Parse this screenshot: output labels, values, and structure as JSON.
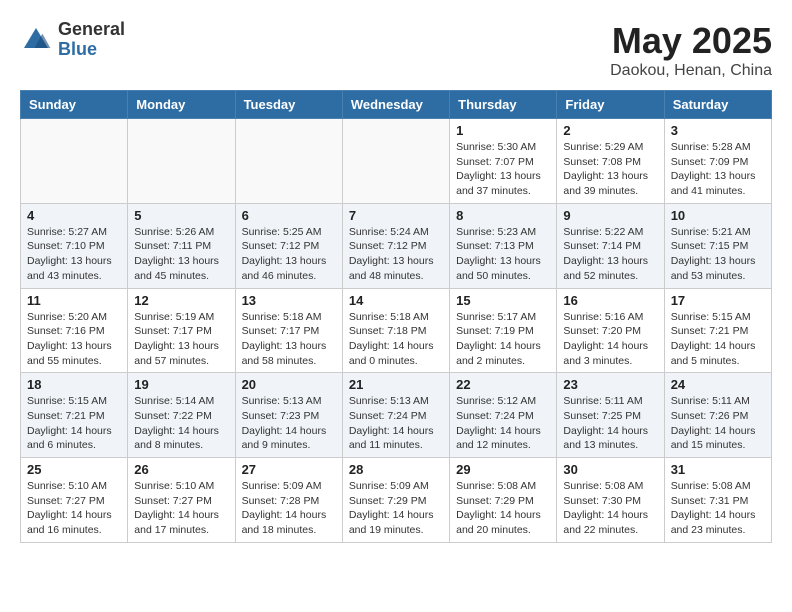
{
  "logo": {
    "general": "General",
    "blue": "Blue"
  },
  "title": {
    "month_year": "May 2025",
    "location": "Daokou, Henan, China"
  },
  "headers": [
    "Sunday",
    "Monday",
    "Tuesday",
    "Wednesday",
    "Thursday",
    "Friday",
    "Saturday"
  ],
  "weeks": [
    [
      {
        "day": "",
        "info": ""
      },
      {
        "day": "",
        "info": ""
      },
      {
        "day": "",
        "info": ""
      },
      {
        "day": "",
        "info": ""
      },
      {
        "day": "1",
        "info": "Sunrise: 5:30 AM\nSunset: 7:07 PM\nDaylight: 13 hours\nand 37 minutes."
      },
      {
        "day": "2",
        "info": "Sunrise: 5:29 AM\nSunset: 7:08 PM\nDaylight: 13 hours\nand 39 minutes."
      },
      {
        "day": "3",
        "info": "Sunrise: 5:28 AM\nSunset: 7:09 PM\nDaylight: 13 hours\nand 41 minutes."
      }
    ],
    [
      {
        "day": "4",
        "info": "Sunrise: 5:27 AM\nSunset: 7:10 PM\nDaylight: 13 hours\nand 43 minutes."
      },
      {
        "day": "5",
        "info": "Sunrise: 5:26 AM\nSunset: 7:11 PM\nDaylight: 13 hours\nand 45 minutes."
      },
      {
        "day": "6",
        "info": "Sunrise: 5:25 AM\nSunset: 7:12 PM\nDaylight: 13 hours\nand 46 minutes."
      },
      {
        "day": "7",
        "info": "Sunrise: 5:24 AM\nSunset: 7:12 PM\nDaylight: 13 hours\nand 48 minutes."
      },
      {
        "day": "8",
        "info": "Sunrise: 5:23 AM\nSunset: 7:13 PM\nDaylight: 13 hours\nand 50 minutes."
      },
      {
        "day": "9",
        "info": "Sunrise: 5:22 AM\nSunset: 7:14 PM\nDaylight: 13 hours\nand 52 minutes."
      },
      {
        "day": "10",
        "info": "Sunrise: 5:21 AM\nSunset: 7:15 PM\nDaylight: 13 hours\nand 53 minutes."
      }
    ],
    [
      {
        "day": "11",
        "info": "Sunrise: 5:20 AM\nSunset: 7:16 PM\nDaylight: 13 hours\nand 55 minutes."
      },
      {
        "day": "12",
        "info": "Sunrise: 5:19 AM\nSunset: 7:17 PM\nDaylight: 13 hours\nand 57 minutes."
      },
      {
        "day": "13",
        "info": "Sunrise: 5:18 AM\nSunset: 7:17 PM\nDaylight: 13 hours\nand 58 minutes."
      },
      {
        "day": "14",
        "info": "Sunrise: 5:18 AM\nSunset: 7:18 PM\nDaylight: 14 hours\nand 0 minutes."
      },
      {
        "day": "15",
        "info": "Sunrise: 5:17 AM\nSunset: 7:19 PM\nDaylight: 14 hours\nand 2 minutes."
      },
      {
        "day": "16",
        "info": "Sunrise: 5:16 AM\nSunset: 7:20 PM\nDaylight: 14 hours\nand 3 minutes."
      },
      {
        "day": "17",
        "info": "Sunrise: 5:15 AM\nSunset: 7:21 PM\nDaylight: 14 hours\nand 5 minutes."
      }
    ],
    [
      {
        "day": "18",
        "info": "Sunrise: 5:15 AM\nSunset: 7:21 PM\nDaylight: 14 hours\nand 6 minutes."
      },
      {
        "day": "19",
        "info": "Sunrise: 5:14 AM\nSunset: 7:22 PM\nDaylight: 14 hours\nand 8 minutes."
      },
      {
        "day": "20",
        "info": "Sunrise: 5:13 AM\nSunset: 7:23 PM\nDaylight: 14 hours\nand 9 minutes."
      },
      {
        "day": "21",
        "info": "Sunrise: 5:13 AM\nSunset: 7:24 PM\nDaylight: 14 hours\nand 11 minutes."
      },
      {
        "day": "22",
        "info": "Sunrise: 5:12 AM\nSunset: 7:24 PM\nDaylight: 14 hours\nand 12 minutes."
      },
      {
        "day": "23",
        "info": "Sunrise: 5:11 AM\nSunset: 7:25 PM\nDaylight: 14 hours\nand 13 minutes."
      },
      {
        "day": "24",
        "info": "Sunrise: 5:11 AM\nSunset: 7:26 PM\nDaylight: 14 hours\nand 15 minutes."
      }
    ],
    [
      {
        "day": "25",
        "info": "Sunrise: 5:10 AM\nSunset: 7:27 PM\nDaylight: 14 hours\nand 16 minutes."
      },
      {
        "day": "26",
        "info": "Sunrise: 5:10 AM\nSunset: 7:27 PM\nDaylight: 14 hours\nand 17 minutes."
      },
      {
        "day": "27",
        "info": "Sunrise: 5:09 AM\nSunset: 7:28 PM\nDaylight: 14 hours\nand 18 minutes."
      },
      {
        "day": "28",
        "info": "Sunrise: 5:09 AM\nSunset: 7:29 PM\nDaylight: 14 hours\nand 19 minutes."
      },
      {
        "day": "29",
        "info": "Sunrise: 5:08 AM\nSunset: 7:29 PM\nDaylight: 14 hours\nand 20 minutes."
      },
      {
        "day": "30",
        "info": "Sunrise: 5:08 AM\nSunset: 7:30 PM\nDaylight: 14 hours\nand 22 minutes."
      },
      {
        "day": "31",
        "info": "Sunrise: 5:08 AM\nSunset: 7:31 PM\nDaylight: 14 hours\nand 23 minutes."
      }
    ]
  ]
}
